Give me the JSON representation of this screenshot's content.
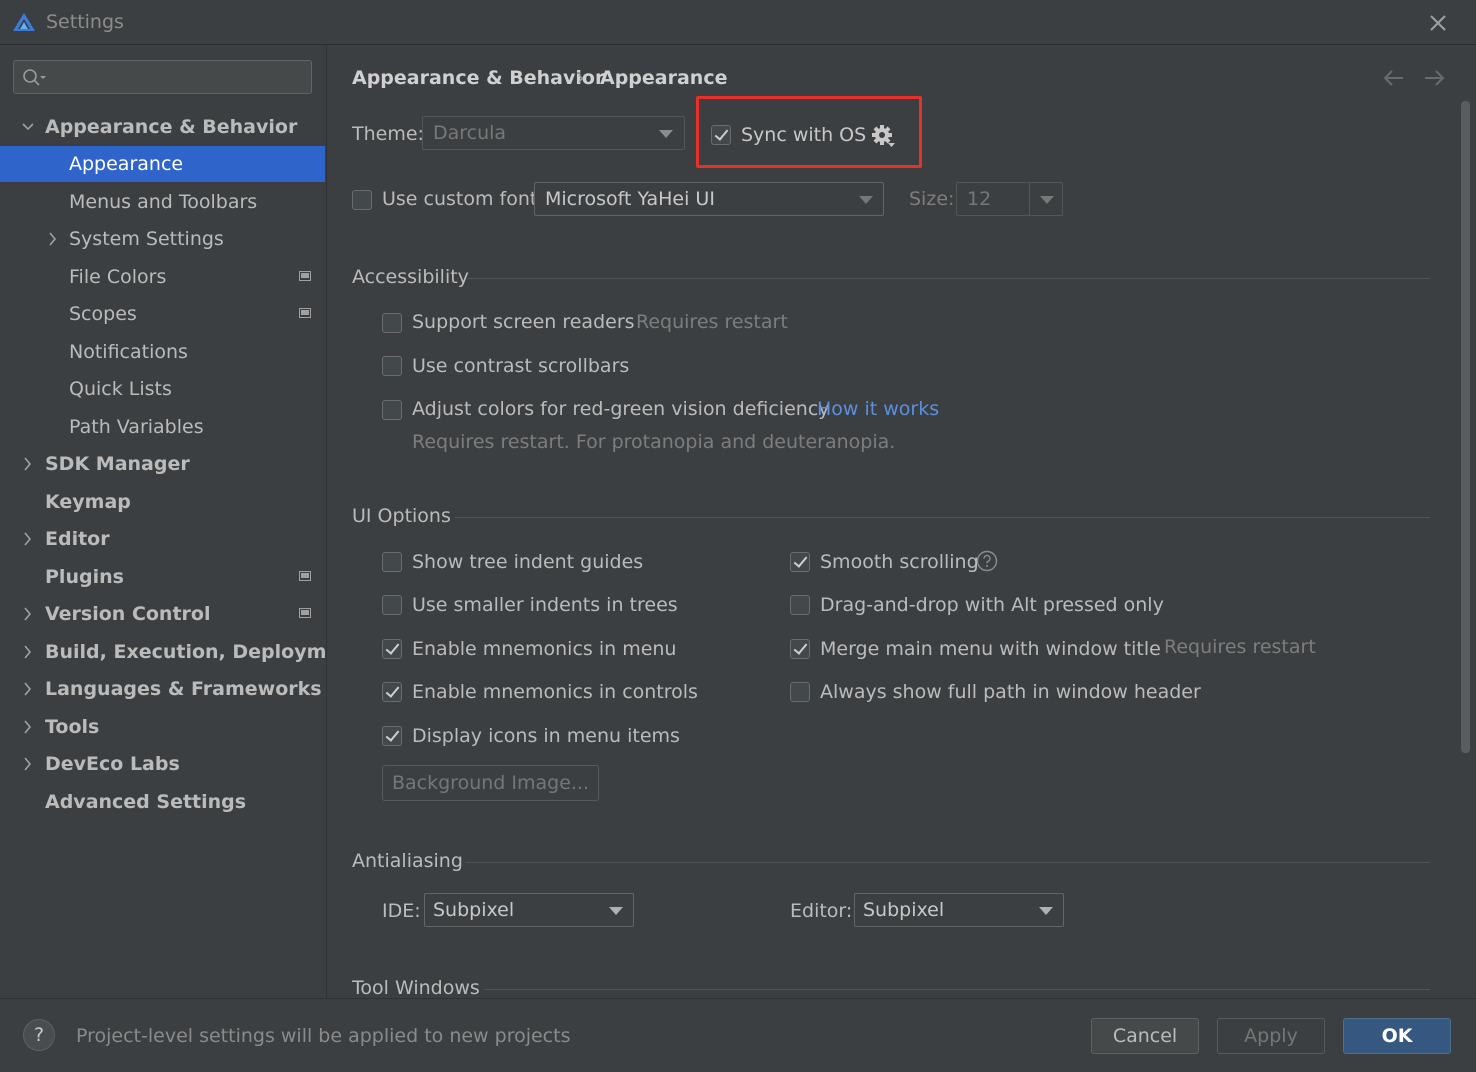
{
  "window": {
    "title": "Settings"
  },
  "sidebar": {
    "search_placeholder": "",
    "items": [
      {
        "label": "Appearance & Behavior",
        "bold": true,
        "expanded": true
      },
      {
        "label": "Appearance",
        "selected": true
      },
      {
        "label": "Menus and Toolbars"
      },
      {
        "label": "System Settings",
        "expandable": true
      },
      {
        "label": "File Colors",
        "project_icon": true
      },
      {
        "label": "Scopes",
        "project_icon": true
      },
      {
        "label": "Notifications"
      },
      {
        "label": "Quick Lists"
      },
      {
        "label": "Path Variables"
      },
      {
        "label": "SDK Manager",
        "bold": true,
        "expandable": true
      },
      {
        "label": "Keymap",
        "bold": true
      },
      {
        "label": "Editor",
        "bold": true,
        "expandable": true
      },
      {
        "label": "Plugins",
        "bold": true,
        "project_icon": true
      },
      {
        "label": "Version Control",
        "bold": true,
        "expandable": true,
        "project_icon": true
      },
      {
        "label": "Build, Execution, Deployment",
        "bold": true,
        "expandable": true
      },
      {
        "label": "Languages & Frameworks",
        "bold": true,
        "expandable": true
      },
      {
        "label": "Tools",
        "bold": true,
        "expandable": true
      },
      {
        "label": "DevEco Labs",
        "bold": true,
        "expandable": true
      },
      {
        "label": "Advanced Settings",
        "bold": true
      }
    ]
  },
  "breadcrumb": {
    "parent": "Appearance & Behavior",
    "separator": "›",
    "current": "Appearance"
  },
  "theme": {
    "label": "Theme:",
    "value": "Darcula",
    "sync_label": "Sync with OS",
    "sync_checked": true
  },
  "font": {
    "checkbox_label": "Use custom font:",
    "checked": false,
    "value": "Microsoft YaHei UI",
    "size_label": "Size:",
    "size_value": "12"
  },
  "accessibility": {
    "title": "Accessibility",
    "screen_readers": {
      "label": "Support screen readers",
      "checked": false,
      "note": "Requires restart"
    },
    "contrast_scrollbars": {
      "label": "Use contrast scrollbars",
      "checked": false
    },
    "color_deficiency": {
      "label": "Adjust colors for red-green vision deficiency",
      "checked": false,
      "link": "How it works",
      "note": "Requires restart. For protanopia and deuteranopia."
    }
  },
  "ui_options": {
    "title": "UI Options",
    "left": [
      {
        "label": "Show tree indent guides",
        "checked": false
      },
      {
        "label": "Use smaller indents in trees",
        "checked": false
      },
      {
        "label": "Enable mnemonics in menu",
        "checked": true
      },
      {
        "label": "Enable mnemonics in controls",
        "checked": true
      },
      {
        "label": "Display icons in menu items",
        "checked": true
      }
    ],
    "right": [
      {
        "label": "Smooth scrolling",
        "checked": true
      },
      {
        "label": "Drag-and-drop with Alt pressed only",
        "checked": false
      },
      {
        "label": "Merge main menu with window title",
        "checked": true,
        "note": "Requires restart"
      },
      {
        "label": "Always show full path in window header",
        "checked": false
      }
    ],
    "background_button": "Background Image..."
  },
  "antialiasing": {
    "title": "Antialiasing",
    "ide_label": "IDE:",
    "ide_value": "Subpixel",
    "editor_label": "Editor:",
    "editor_value": "Subpixel"
  },
  "tool_windows": {
    "title": "Tool Windows"
  },
  "footer": {
    "help": "?",
    "message": "Project-level settings will be applied to new projects",
    "cancel": "Cancel",
    "apply": "Apply",
    "ok": "OK"
  },
  "colors": {
    "selection": "#2f65ca",
    "link": "#5b8fe0",
    "highlight": "#e8302a",
    "primary_button": "#365880"
  },
  "icons": [
    "app-logo-icon",
    "close-icon",
    "search-icon",
    "chevron-down-icon",
    "chevron-right-icon",
    "gear-icon",
    "back-arrow-icon",
    "forward-arrow-icon",
    "help-icon",
    "project-level-icon"
  ]
}
